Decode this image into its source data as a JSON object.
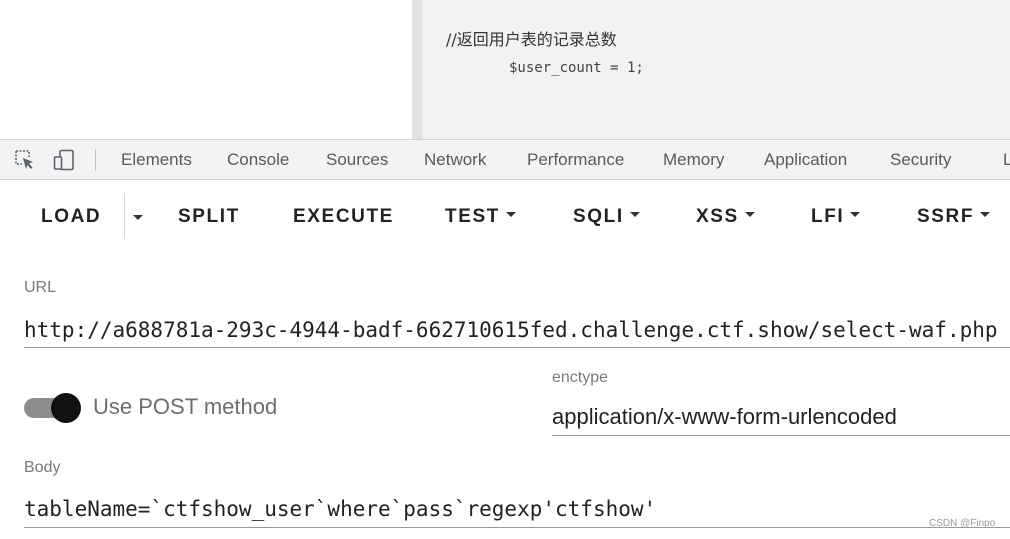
{
  "page": {
    "code_comment": "//返回用户表的记录总数",
    "code_line": "$user_count = 1;"
  },
  "devtools": {
    "icons": [
      "inspect-element-icon",
      "device-toggle-icon"
    ],
    "tabs": [
      "Elements",
      "Console",
      "Sources",
      "Network",
      "Performance",
      "Memory",
      "Application",
      "Security",
      "L"
    ]
  },
  "hackbar": {
    "buttons": {
      "load": "LOAD",
      "split": "SPLIT",
      "execute": "EXECUTE",
      "test": "TEST",
      "sqli": "SQLI",
      "xss": "XSS",
      "lfi": "LFI",
      "ssrf": "SSRF"
    },
    "url_label": "URL",
    "url_value": "http://a688781a-293c-4944-badf-662710615fed.challenge.ctf.show/select-waf.php",
    "post_toggle_label": "Use POST method",
    "post_enabled": true,
    "enctype_label": "enctype",
    "enctype_value": "application/x-www-form-urlencoded",
    "body_label": "Body",
    "body_value": "tableName=`ctfshow_user`where`pass`regexp'ctfshow'"
  },
  "watermark": "CSDN @Finpo",
  "colors": {
    "devtools_bg": "#f1f3f4",
    "code_panel_bg": "#f2f2f2",
    "toggle_knob": "#111111",
    "toggle_track": "#8d8d8d"
  }
}
